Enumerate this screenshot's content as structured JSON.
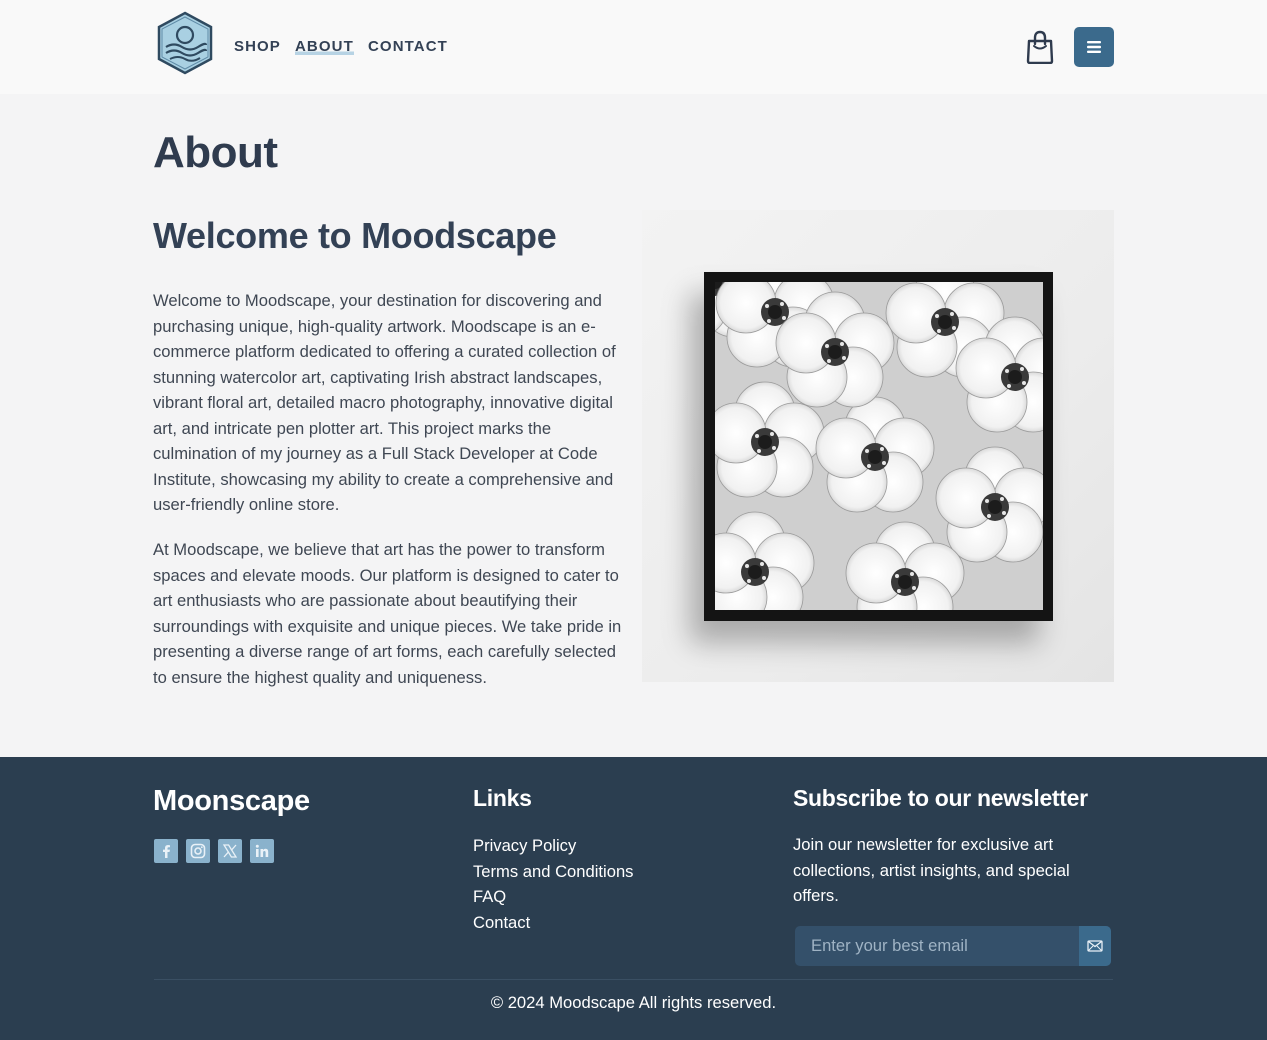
{
  "header": {
    "nav": {
      "shop": "SHOP",
      "about": "ABOUT",
      "contact": "CONTACT"
    },
    "icons": {
      "logo": "moodscape-logo",
      "cart": "shopping-bag-icon",
      "menu": "hamburger-menu-icon"
    },
    "accent_color": "#3b6a8c"
  },
  "main": {
    "title": "About",
    "heading": "Welcome to Moodscape",
    "paragraphs": [
      "Welcome to Moodscape, your destination for discovering and purchasing unique, high-quality artwork. Moodscape is an e-commerce platform dedicated to offering a curated collection of stunning watercolor art, captivating Irish abstract landscapes, vibrant floral art, detailed macro photography, innovative digital art, and intricate pen plotter art. This project marks the culmination of my journey as a Full Stack Developer at Code Institute, showcasing my ability to create a comprehensive and user-friendly online store.",
      "At Moodscape, we believe that art has the power to transform spaces and elevate moods. Our platform is designed to cater to art enthusiasts who are passionate about beautifying their surroundings with exquisite and unique pieces. We take pride in presenting a diverse range of art forms, each carefully selected to ensure the highest quality and uniqueness."
    ]
  },
  "footer": {
    "brand": "Moonscape",
    "socials": [
      "facebook-icon",
      "instagram-icon",
      "x-icon",
      "linkedin-icon"
    ],
    "links_title": "Links",
    "links": [
      "Privacy Policy",
      "Terms and Conditions",
      "FAQ",
      "Contact"
    ],
    "newsletter_title": "Subscribe to our newsletter",
    "newsletter_text": "Join our newsletter for exclusive art collections, artist insights, and special offers.",
    "email_placeholder": "Enter your best email",
    "copyright": "© 2024 Moodscape All rights reserved.",
    "background_color": "#2b3e50"
  }
}
